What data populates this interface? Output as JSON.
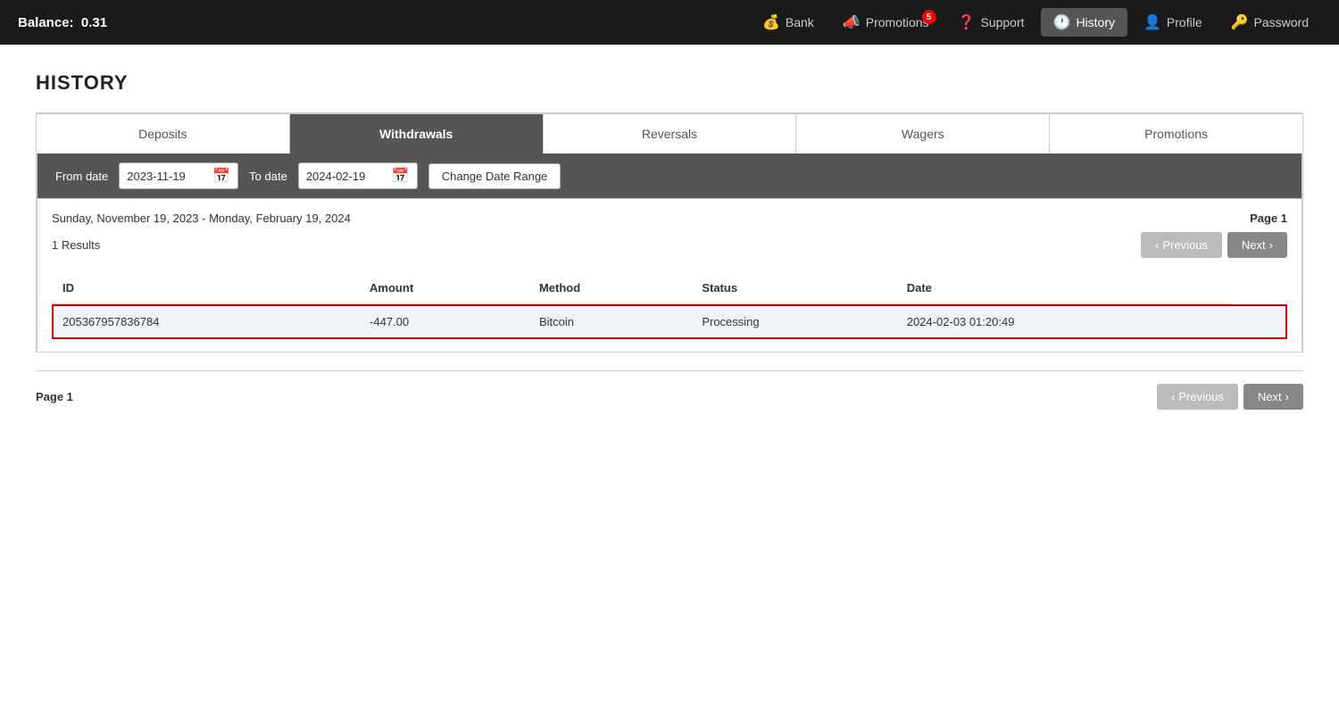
{
  "header": {
    "balance_label": "Balance:",
    "balance_value": "0.31",
    "nav": [
      {
        "id": "bank",
        "label": "Bank",
        "icon": "💰",
        "badge": null,
        "active": false
      },
      {
        "id": "promotions",
        "label": "Promotions",
        "icon": "📣",
        "badge": "5",
        "active": false
      },
      {
        "id": "support",
        "label": "Support",
        "icon": "❓",
        "badge": null,
        "active": false
      },
      {
        "id": "history",
        "label": "History",
        "icon": "🕐",
        "badge": null,
        "active": true
      },
      {
        "id": "profile",
        "label": "Profile",
        "icon": "👤",
        "badge": null,
        "active": false
      },
      {
        "id": "password",
        "label": "Password",
        "icon": "🔑",
        "badge": null,
        "active": false
      }
    ]
  },
  "page": {
    "title": "HISTORY"
  },
  "tabs": [
    {
      "id": "deposits",
      "label": "Deposits",
      "active": false
    },
    {
      "id": "withdrawals",
      "label": "Withdrawals",
      "active": true
    },
    {
      "id": "reversals",
      "label": "Reversals",
      "active": false
    },
    {
      "id": "wagers",
      "label": "Wagers",
      "active": false
    },
    {
      "id": "promotions",
      "label": "Promotions",
      "active": false
    }
  ],
  "date_filter": {
    "from_label": "From date",
    "from_value": "2023-11-19",
    "to_label": "To date",
    "to_value": "2024-02-19",
    "change_btn_label": "Change Date Range"
  },
  "results": {
    "date_range_text": "Sunday, November 19, 2023 - Monday, February 19, 2024",
    "page_label": "Page 1",
    "count_text": "1 Results",
    "prev_label": "Previous",
    "next_label": "Next"
  },
  "table": {
    "columns": [
      "ID",
      "Amount",
      "Method",
      "Status",
      "Date"
    ],
    "rows": [
      {
        "id": "205367957836784",
        "amount": "-447.00",
        "method": "Bitcoin",
        "status": "Processing",
        "date": "2024-02-03 01:20:49",
        "highlighted": true
      }
    ]
  },
  "footer": {
    "page_label": "Page 1",
    "prev_label": "Previous",
    "next_label": "Next"
  }
}
